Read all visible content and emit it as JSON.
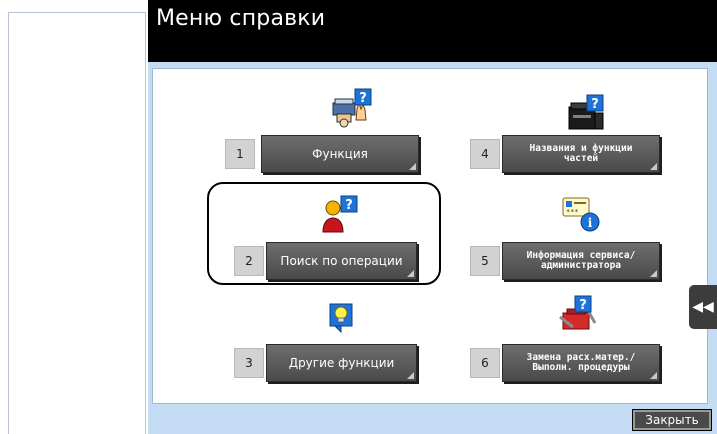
{
  "header": {
    "title": "Меню справки"
  },
  "menu": {
    "items": [
      {
        "num": "1",
        "label": "Функция",
        "icon": "function-help-icon"
      },
      {
        "num": "2",
        "label": "Поиск по операции",
        "icon": "person-help-icon"
      },
      {
        "num": "3",
        "label": "Другие функции",
        "icon": "lightbulb-help-icon"
      },
      {
        "num": "4",
        "label": "Названия и функции частей",
        "icon": "printer-help-icon"
      },
      {
        "num": "5",
        "label": "Информация сервиса/администратора",
        "icon": "id-card-info-icon"
      },
      {
        "num": "6",
        "label": "Замена расх.матер./ Выполн. процедуры",
        "icon": "tools-help-icon"
      }
    ]
  },
  "side_tab": {
    "label": "◀◀"
  },
  "footer": {
    "close_label": "Закрыть"
  },
  "colors": {
    "accent_bg": "#c4dbf4",
    "button": "#5a5a5a",
    "title_bar": "#000000",
    "help_blue": "#1e74d6"
  }
}
